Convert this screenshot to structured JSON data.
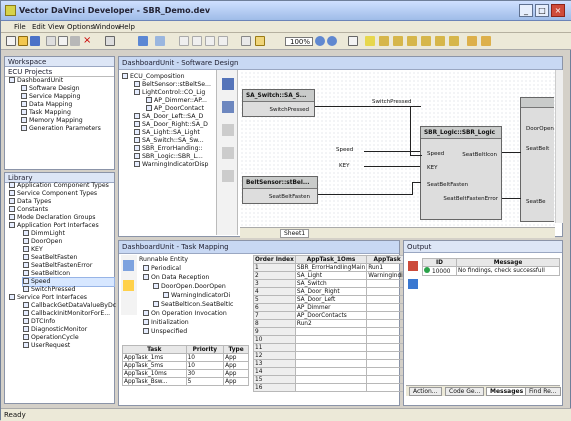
{
  "window": {
    "title": "Vector DaVinci Developer - SBR_Demo.dev"
  },
  "menu": [
    "File",
    "Edit",
    "View",
    "Options",
    "Window",
    "Help"
  ],
  "toolbar": {
    "zoom": "100%"
  },
  "workspace": {
    "title": "Workspace",
    "tab": "ECU Projects",
    "items": [
      "DashboardUnit",
      "Software Design",
      "Service Mapping",
      "Data Mapping",
      "Task Mapping",
      "Memory Mapping",
      "Generation Parameters"
    ]
  },
  "library": {
    "title": "Library",
    "items": [
      "Application Component Types",
      "Service Component Types",
      "Data Types",
      "Constants",
      "Mode Declaration Groups",
      "Application Port Interfaces",
      "DimmLight",
      "DoorOpen",
      "KEY",
      "SeatBeltFasten",
      "SeatBeltFastenError",
      "SeatBeltIcon",
      "Speed",
      "SwitchPressed",
      "Service Port Interfaces",
      "CallbackGetDataValueByDc",
      "CallbackInitMonitorForE...",
      "DTCInfo",
      "DiagnosticMonitor",
      "OperationCycle",
      "UserRequest"
    ]
  },
  "software_design": {
    "title": "DashboardUnit - Software Design",
    "tree": [
      "ECU_Composition",
      "BeltSensor::stBeltSe...",
      "LightControl::CO_Lig",
      "AP_Dimmer::AP...",
      "AP_DoorContact",
      "SA_Door_Left::SA_D",
      "SA_Door_Right::SA_D",
      "SA_Light::SA_Light",
      "SA_Switch::SA_Sw...",
      "SBR_ErrorHanding::",
      "SBR_Logic::SBR_L...",
      "WarningIndicatorDisp"
    ],
    "components": {
      "switch": "SA_Switch::SA_S...",
      "switch_port": "SwitchPressed",
      "belt": "BeltSensor::stBel...",
      "belt_port": "SeatBeltFasten",
      "logic": "SBR_Logic::SBR_Logic",
      "logic_ports": [
        "Speed",
        "KEY",
        "SeatBeltFasten",
        "SeatBeltIcon",
        "SeatBeltFastenError"
      ],
      "logic_label_switch": "SwitchPressed",
      "speed": "Speed",
      "key": "KEY",
      "door": "DoorOpen",
      "right_port1": "SeatBelt",
      "right_port2": "SeatBe",
      "sheet": "Sheet1"
    }
  },
  "task_mapping": {
    "title": "DashboardUnit - Task Mapping",
    "runnable_title": "Runnable Entity",
    "runnable_items": [
      "Periodical",
      "On Data Reception",
      "DoorOpen.DoorOpen",
      "WarningIndicatorDi",
      "SeatBeltIcon.SeatBeltIc",
      "On Operation Invocation",
      "Initialization",
      "Unspecified"
    ],
    "task_headers": [
      "Task",
      "Priority",
      "Type"
    ],
    "tasks": [
      [
        "AppTask_1ms",
        "10",
        "App"
      ],
      [
        "AppTask_5ms",
        "10",
        "App"
      ],
      [
        "AppTask_10ms",
        "30",
        "App"
      ],
      [
        "AppTask_Bsw...",
        "5",
        "App"
      ]
    ],
    "order_headers": [
      "Order Index",
      "AppTask_1Oms",
      "AppTask"
    ],
    "orders": [
      [
        "1",
        "SBR_ErrorHandlingMain",
        "Run1"
      ],
      [
        "2",
        "SA_Light",
        "WarningIndic"
      ],
      [
        "3",
        "SA_Switch",
        ""
      ],
      [
        "4",
        "SA_Door_Right",
        ""
      ],
      [
        "5",
        "SA_Door_Left",
        ""
      ],
      [
        "6",
        "AP_Dimmer",
        ""
      ],
      [
        "7",
        "AP_DoorContacts",
        ""
      ],
      [
        "8",
        "Run2",
        ""
      ],
      [
        "9",
        "",
        ""
      ],
      [
        "10",
        "",
        ""
      ],
      [
        "11",
        "",
        ""
      ],
      [
        "12",
        "",
        ""
      ],
      [
        "13",
        "",
        ""
      ],
      [
        "14",
        "",
        ""
      ],
      [
        "15",
        "",
        ""
      ],
      [
        "16",
        "",
        ""
      ]
    ]
  },
  "output": {
    "title": "Output",
    "headers": [
      "ID",
      "Message"
    ],
    "rows": [
      [
        "10000",
        "No findings, check successfull"
      ]
    ],
    "tabs": [
      "Action...",
      "Code Ge...",
      "Messages",
      "Find Re..."
    ]
  },
  "status": "Ready"
}
